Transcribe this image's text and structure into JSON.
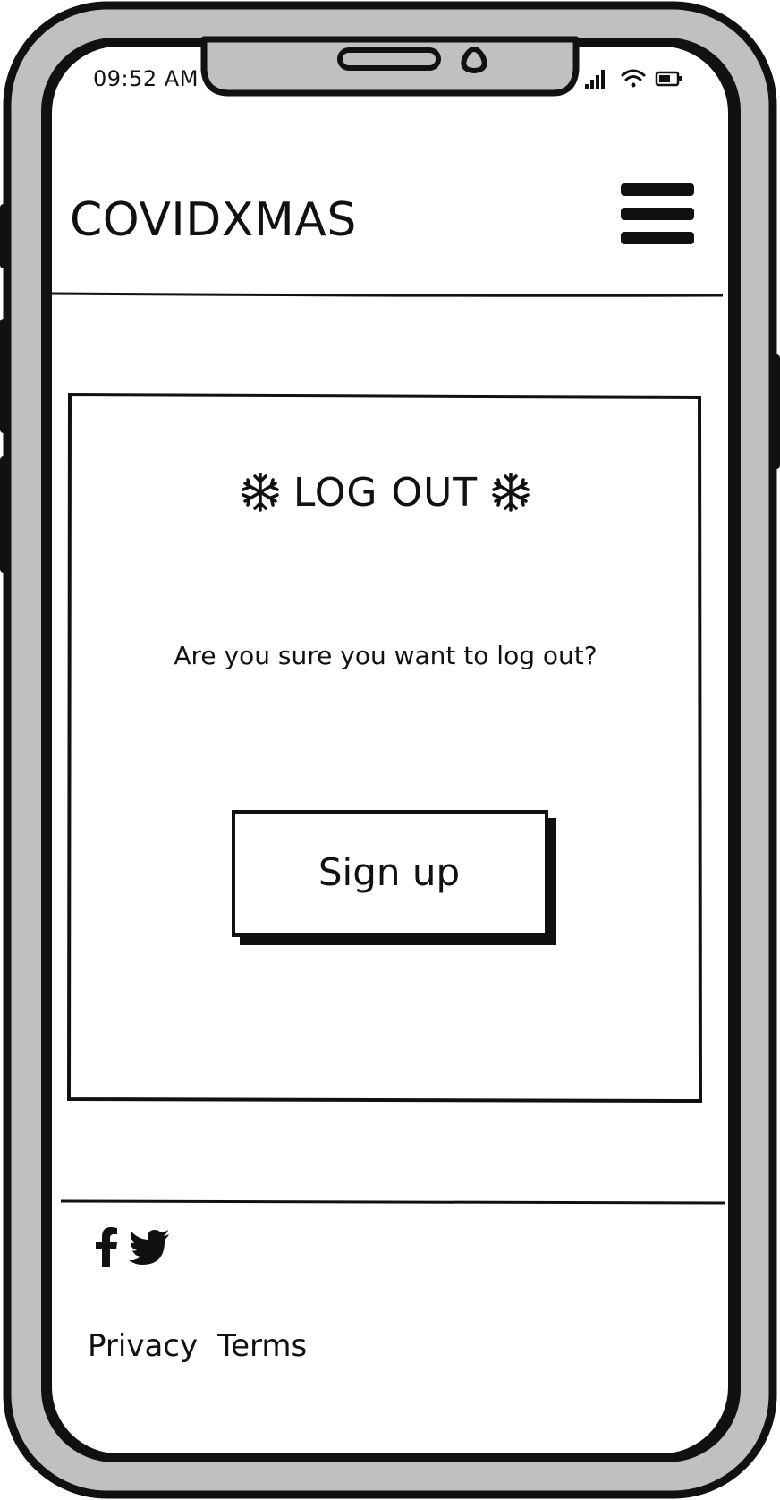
{
  "status_bar": {
    "time": "09:52 AM",
    "icons": [
      "signal-icon",
      "wifi-icon",
      "battery-icon"
    ]
  },
  "header": {
    "brand": "COVIDXMAS",
    "menu_icon": "hamburger-menu-icon"
  },
  "card": {
    "title": "LOG OUT",
    "title_icons": [
      "snowflake-icon",
      "snowflake-icon"
    ],
    "message": "Are you sure you want to log out?",
    "button_label": "Sign up"
  },
  "footer": {
    "social": [
      "facebook-icon",
      "twitter-icon"
    ],
    "links": [
      "Privacy",
      "Terms"
    ]
  },
  "colors": {
    "frame": "#c0c0c0",
    "stroke": "#111111",
    "screen": "#ffffff"
  }
}
